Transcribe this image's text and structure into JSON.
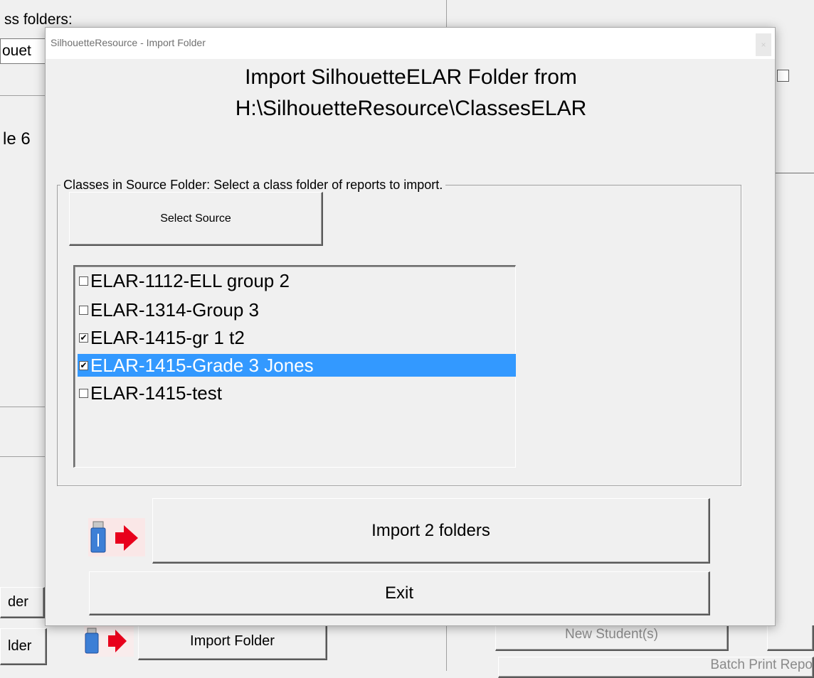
{
  "background": {
    "folders_label": "ss folders:",
    "silhouette_field": "ouet",
    "grade_label": "le 6",
    "folder_button_1": "der",
    "folder_button_2": "lder",
    "import_folder_button": "Import Folder",
    "new_students_button": "New Student(s)",
    "batch_print_button": "Batch Print Repo"
  },
  "dialog": {
    "title": "SilhouetteResource - Import Folder",
    "close_glyph": "×",
    "heading_line1": "Import SilhouetteELAR Folder from",
    "heading_line2": "H:\\SilhouetteResource\\ClassesELAR",
    "group_legend": "Classes in Source Folder: Select a class folder of reports to import.",
    "select_source_button": "Select Source",
    "list_items": [
      {
        "label": "ELAR-1112-ELL group 2",
        "checked": false,
        "selected": false
      },
      {
        "label": "ELAR-1314-Group 3",
        "checked": false,
        "selected": false
      },
      {
        "label": "ELAR-1415-gr 1 t2",
        "checked": true,
        "selected": false
      },
      {
        "label": "ELAR-1415-Grade 3 Jones",
        "checked": true,
        "selected": true
      },
      {
        "label": "ELAR-1415-test",
        "checked": false,
        "selected": false
      }
    ],
    "check_glyph": "✔",
    "import_button": "Import 2 folders",
    "exit_button": "Exit"
  },
  "icons": {
    "usb_icon": "usb-drive-icon",
    "arrow_icon": "red-arrow-right-icon"
  },
  "colors": {
    "selection": "#3399ff",
    "arrow": "#e8001c"
  }
}
